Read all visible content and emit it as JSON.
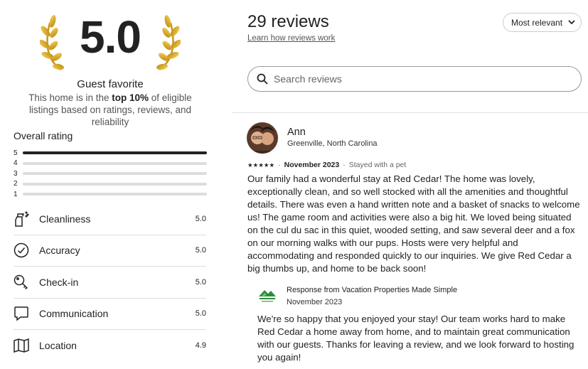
{
  "summary": {
    "score": "5.0",
    "badge_title": "Guest favorite",
    "desc_prefix": "This home is in the ",
    "desc_bold": "top 10%",
    "desc_suffix": " of eligible listings based on ratings, reviews, and reliability"
  },
  "overall": {
    "label": "Overall rating",
    "bars": [
      {
        "label": "5",
        "fraction": 1.0
      },
      {
        "label": "4",
        "fraction": 0.0
      },
      {
        "label": "3",
        "fraction": 0.0
      },
      {
        "label": "2",
        "fraction": 0.0
      },
      {
        "label": "1",
        "fraction": 0.0
      }
    ]
  },
  "categories": [
    {
      "label": "Cleanliness",
      "score": "5.0",
      "icon": "spray-bottle-icon"
    },
    {
      "label": "Accuracy",
      "score": "5.0",
      "icon": "check-circle-icon"
    },
    {
      "label": "Check-in",
      "score": "5.0",
      "icon": "key-icon"
    },
    {
      "label": "Communication",
      "score": "5.0",
      "icon": "chat-bubble-icon"
    },
    {
      "label": "Location",
      "score": "4.9",
      "icon": "map-icon"
    }
  ],
  "header": {
    "title": "29 reviews",
    "learn_link": "Learn how reviews work",
    "sort_label": "Most relevant"
  },
  "search": {
    "placeholder": "Search reviews"
  },
  "review": {
    "name": "Ann",
    "location": "Greenville, North Carolina",
    "stars": "★★★★★",
    "date": "November 2023",
    "stay": "Stayed with a pet",
    "text": "Our family had a wonderful stay at Red Cedar! The home was lovely, exceptionally clean, and so well stocked with all the amenities and thoughtful details. There was even a hand written note and a basket of snacks to welcome us! The game room and activities were also a big hit. We loved being situated on the cul du sac in this quiet, wooded setting, and saw several deer and a fox on our morning walks with our pups. Hosts were very helpful and accommodating and responded quickly to our inquiries. We give Red Cedar a big thumbs up, and home to be back soon!"
  },
  "response": {
    "title": "Response from Vacation Properties Made Simple",
    "date": "November 2023",
    "text": "We're so happy that you enjoyed your stay! Our team works hard to make Red Cedar a home away from home, and to maintain great communication with our guests. Thanks for leaving a review, and we look forward to hosting you again!"
  },
  "colors": {
    "text": "#222222",
    "muted": "#555555",
    "bar": "#222222",
    "logo_green": "#2e8b3a",
    "laurel_gold": "#d4a017"
  }
}
